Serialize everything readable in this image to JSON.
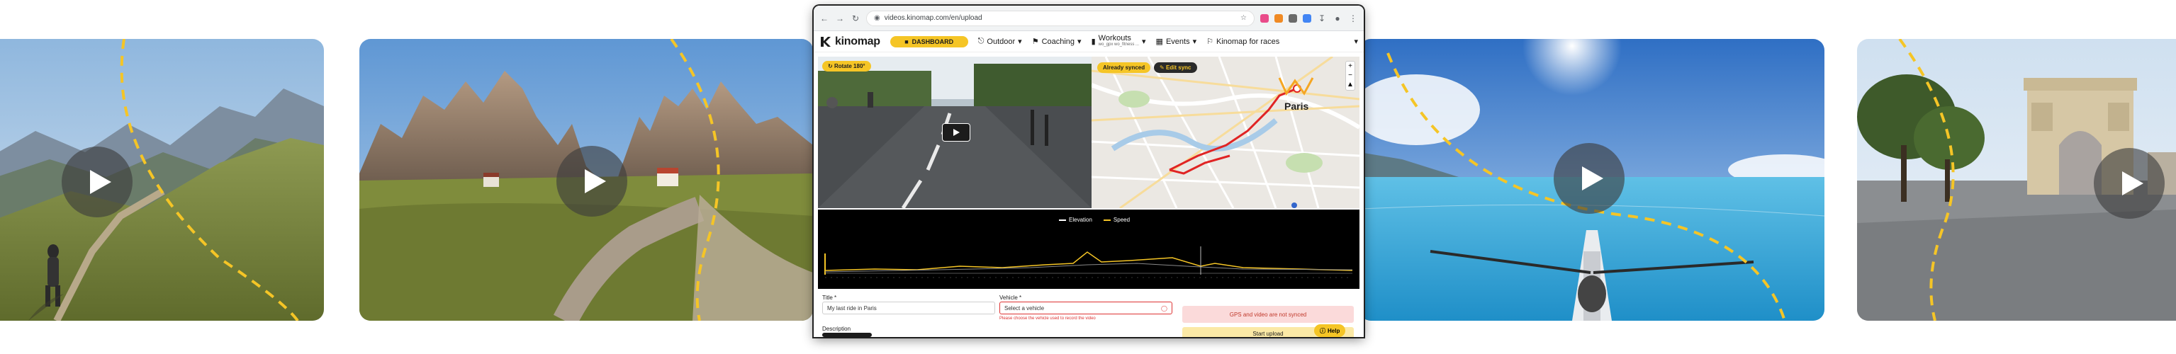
{
  "browser": {
    "url": "videos.kinomap.com/en/upload",
    "colors": {
      "accent": "#f5c526",
      "route": "#e02424",
      "error": "#d33333"
    }
  },
  "site": {
    "logo": "kinomap",
    "dashboard_label": "DASHBOARD",
    "nav": [
      {
        "label": "Outdoor",
        "icon": "compass-icon"
      },
      {
        "label": "Coaching",
        "icon": "coaching-icon"
      },
      {
        "label": "Workouts",
        "sub": "wo_gpx  wo_fitness  ...",
        "icon": "chart-icon"
      },
      {
        "label": "Events",
        "icon": "calendar-icon"
      },
      {
        "label": "Kinomap for races",
        "icon": "flag-icon"
      }
    ]
  },
  "editor": {
    "rotate_label": "Rotate 180°",
    "already_synced_label": "Already synced",
    "edit_sync_label": "Edit sync",
    "map_city": "Paris",
    "legend": {
      "elevation": "Elevation",
      "speed": "Speed"
    }
  },
  "form": {
    "title_label": "Title *",
    "title_value": "My last ride in Paris",
    "vehicle_label": "Vehicle *",
    "vehicle_placeholder": "Select a vehicle",
    "vehicle_error": "Please choose the vehicle used to record the video",
    "gps_status": "GPS and video are not synced",
    "start_upload": "Start upload",
    "description_label": "Description",
    "help_label": "Help"
  }
}
